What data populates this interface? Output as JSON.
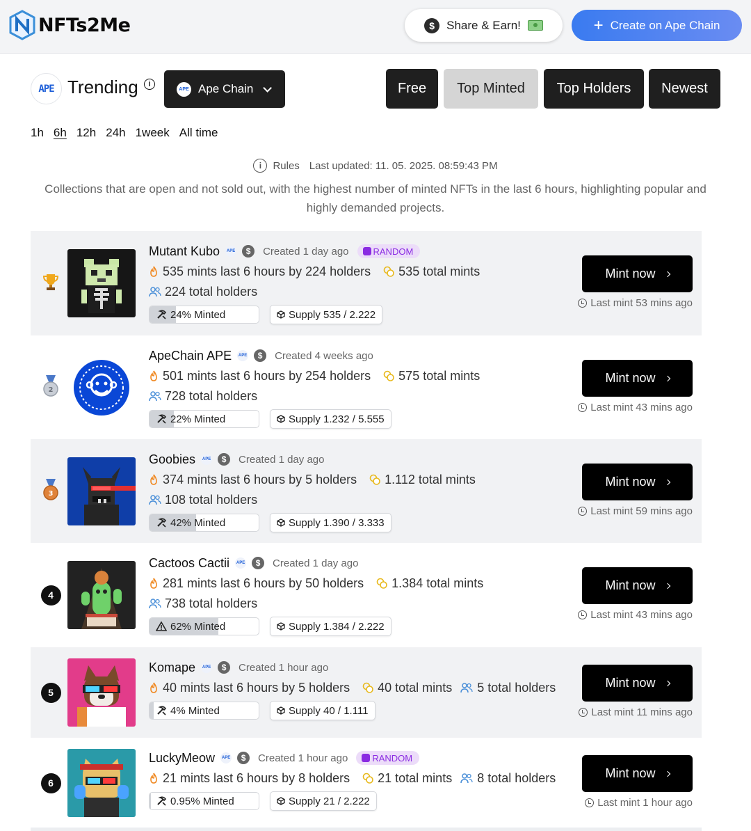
{
  "header": {
    "logo_text": "NFTs2Me",
    "share_label": "Share & Earn!",
    "create_label": "Create on Ape Chain",
    "accent_color": "#3a7bf0"
  },
  "trending": {
    "chain_badge": "APE",
    "title": "Trending",
    "chain_select": "Ape Chain",
    "filters": [
      "Free",
      "Top Minted",
      "Top Holders",
      "Newest"
    ],
    "active_filter": "Top Minted",
    "time_ranges": [
      "1h",
      "6h",
      "12h",
      "24h",
      "1week",
      "All time"
    ],
    "active_time_range": "6h",
    "rules_label": "Rules",
    "last_updated": "Last updated: 11. 05. 2025. 08:59:43 PM",
    "description": "Collections that are open and not sold out, with the highest number of minted NFTs in the last 6 hours, highlighting popular and highly demanded projects."
  },
  "collections": [
    {
      "rank": "1",
      "rank_icon": "trophy-icon",
      "name": "Mutant Kubo",
      "created": "Created 1 day ago",
      "badge": "RANDOM",
      "recent": "535 mints last 6 hours by 224 holders",
      "total_mints": "535 total mints",
      "total_holders": "224 total holders",
      "minted_pct": "24% Minted",
      "minted_fraction": 0.24,
      "supply": "Supply 535 / 2.222",
      "mint_label": "Mint now",
      "last_mint": "Last mint 53 mins ago"
    },
    {
      "rank": "2",
      "rank_icon": "silver-medal-icon",
      "name": "ApeChain APE",
      "created": "Created 4 weeks ago",
      "badge": "",
      "recent": "501 mints last 6 hours by 254 holders",
      "total_mints": "575 total mints",
      "total_holders": "728 total holders",
      "minted_pct": "22% Minted",
      "minted_fraction": 0.22,
      "supply": "Supply 1.232 / 5.555",
      "mint_label": "Mint now",
      "last_mint": "Last mint 43 mins ago"
    },
    {
      "rank": "3",
      "rank_icon": "bronze-medal-icon",
      "name": "Goobies",
      "created": "Created 1 day ago",
      "badge": "",
      "recent": "374 mints last 6 hours by 5 holders",
      "total_mints": "1.112 total mints",
      "total_holders": "108 total holders",
      "minted_pct": "42% Minted",
      "minted_fraction": 0.42,
      "supply": "Supply 1.390 / 3.333",
      "mint_label": "Mint now",
      "last_mint": "Last mint 59 mins ago"
    },
    {
      "rank": "4",
      "rank_icon": "",
      "name": "Cactoos Cactii",
      "created": "Created 1 day ago",
      "badge": "",
      "recent": "281 mints last 6 hours by 50 holders",
      "total_mints": "1.384 total mints",
      "total_holders": "738 total holders",
      "minted_pct": "62% Minted",
      "minted_fraction": 0.62,
      "supply": "Supply 1.384 / 2.222",
      "mint_label": "Mint now",
      "last_mint": "Last mint 43 mins ago"
    },
    {
      "rank": "5",
      "rank_icon": "",
      "name": "Komape",
      "created": "Created 1 hour ago",
      "badge": "",
      "recent": "40 mints last 6 hours by 5 holders",
      "total_mints": "40 total mints",
      "total_holders": "5 total holders",
      "minted_pct": "4% Minted",
      "minted_fraction": 0.04,
      "supply": "Supply 40 / 1.111",
      "mint_label": "Mint now",
      "last_mint": "Last mint 11 mins ago"
    },
    {
      "rank": "6",
      "rank_icon": "",
      "name": "LuckyMeow",
      "created": "Created 1 hour ago",
      "badge": "RANDOM",
      "recent": "21 mints last 6 hours by 8 holders",
      "total_mints": "21 total mints",
      "total_holders": "8 total holders",
      "minted_pct": "0.95% Minted",
      "minted_fraction": 0.0095,
      "supply": "Supply 21 / 2.222",
      "mint_label": "Mint now",
      "last_mint": "Last mint 1 hour ago"
    }
  ]
}
